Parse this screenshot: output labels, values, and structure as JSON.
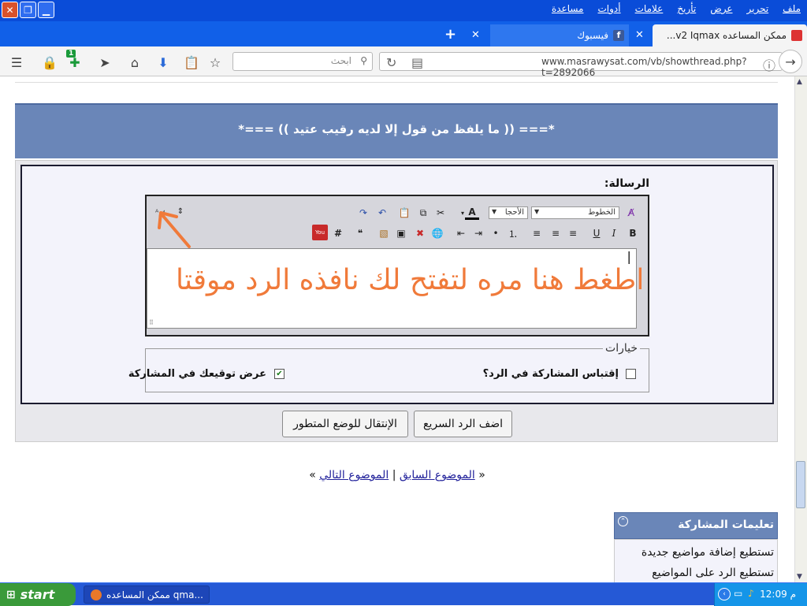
{
  "window": {
    "menu": [
      "ملف",
      "تحرير",
      "عرض",
      "تأريخ",
      "علامات",
      "أدوات",
      "مساعدة"
    ]
  },
  "tabs": [
    {
      "label": "ممكن المساعده v2 Iqmax...",
      "active": true
    },
    {
      "label": "فيسبوك",
      "active": false
    }
  ],
  "nav": {
    "url": "www.masrawysat.com/vb/showthread.php?t=2892066",
    "search_placeholder": "ابحث",
    "badge": "1"
  },
  "page": {
    "quote": "*=== (( ما يلفظ من قول إلا لديه رقيب عتيد )) ===*",
    "message_label": "الرسالة:",
    "font_select": "الخطوط",
    "size_select": "الأحجا",
    "editor_cursor": "|",
    "annotation": "اطغط هنا مره لتفتح لك نافذه الرد موقتا",
    "options_legend": "خيارات",
    "quote_option": "إقتباس المشاركة في الرد؟",
    "quote_checked": false,
    "signature_option": "عرض توقيعك في المشاركة",
    "signature_checked": true,
    "quick_reply_button": "اضف الرد السريع",
    "advanced_button": "الإنتقال للوضع المتطور",
    "nav_open": "«",
    "prev_thread": "الموضوع السابق",
    "separator": "|",
    "next_thread": "الموضوع التالي",
    "nav_close": "»",
    "rules_title": "تعليمات المشاركة",
    "rules": [
      "تستطيع إضافة مواضيع جديدة",
      "تستطيع الرد على المواضيع"
    ]
  },
  "taskbar": {
    "start_label": "start",
    "task_label": "ممكن المساعده qma...",
    "clock": "م 12:09"
  },
  "colors": {
    "header": "#6a86b8",
    "annotation": "#f07a3a",
    "titlebar": "#0a4cd8"
  }
}
